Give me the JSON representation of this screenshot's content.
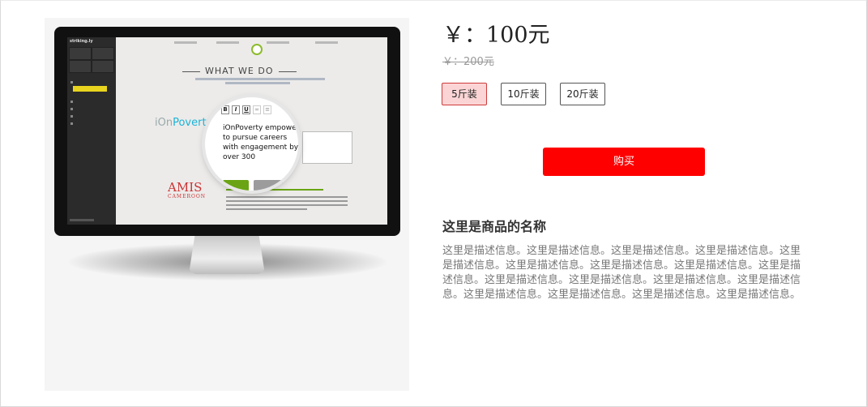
{
  "product": {
    "image_alt": "monitor showing iOnPoverty website editor",
    "screen": {
      "brand": "striking.ly",
      "heading": "WHAT WE DO",
      "logo_text": "iOnPoverty",
      "logo_text_main": "iOn",
      "logo_text_accent": "Povert",
      "editor_text": "iOnPoverty empowers to pursue careers with engagement by over 300",
      "amis_logo": "AMIS",
      "amis_sub": "CAMEROON"
    },
    "price": "￥：100元",
    "original_price": "￥：200元",
    "specs": [
      {
        "label": "5斤装",
        "selected": true
      },
      {
        "label": "10斤装",
        "selected": false
      },
      {
        "label": "20斤装",
        "selected": false
      }
    ],
    "buy_label": "购买",
    "name": "这里是商品的名称",
    "description": "这里是描述信息。这里是描述信息。这里是描述信息。这里是描述信息。这里是描述信息。这里是描述信息。这里是描述信息。这里是描述信息。这里是描述信息。这里是描述信息。这里是描述信息。这里是描述信息。这里是描述信息。这里是描述信息。这里是描述信息。这里是描述信息。这里是描述信息。"
  },
  "colors": {
    "buy_button": "#fe0000",
    "selected_spec_bg": "#fbd5d5",
    "selected_spec_border": "#cf3b3b"
  }
}
